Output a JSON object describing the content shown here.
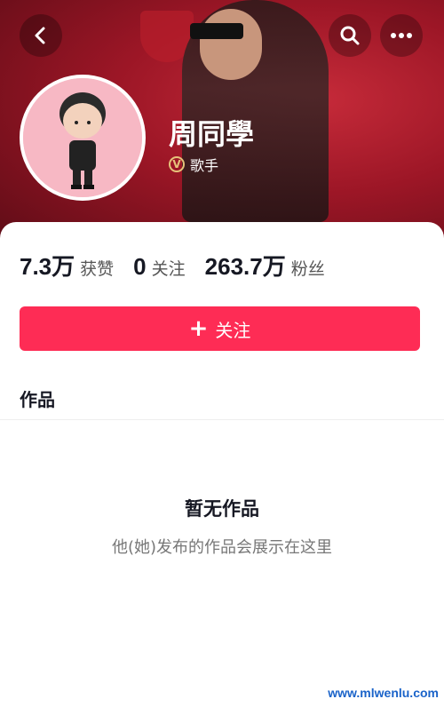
{
  "header": {
    "back_icon": "chevron-left-icon",
    "search_icon": "search-icon",
    "more_icon": "more-horizontal-icon"
  },
  "profile": {
    "name": "周同學",
    "badge_letter": "V",
    "badge_label": "歌手"
  },
  "stats": [
    {
      "value": "7.3万",
      "label": "获赞"
    },
    {
      "value": "0",
      "label": "关注"
    },
    {
      "value": "263.7万",
      "label": "粉丝"
    }
  ],
  "follow_button": {
    "plus": "+",
    "label": "关注"
  },
  "tabs": {
    "works": "作品"
  },
  "empty_state": {
    "title": "暂无作品",
    "subtitle": "他(她)发布的作品会展示在这里"
  },
  "watermark": "www.mlwenlu.com",
  "colors": {
    "accent": "#fe2c55",
    "header_red": "#9c1626",
    "avatar_bg": "#f7b8c4"
  }
}
